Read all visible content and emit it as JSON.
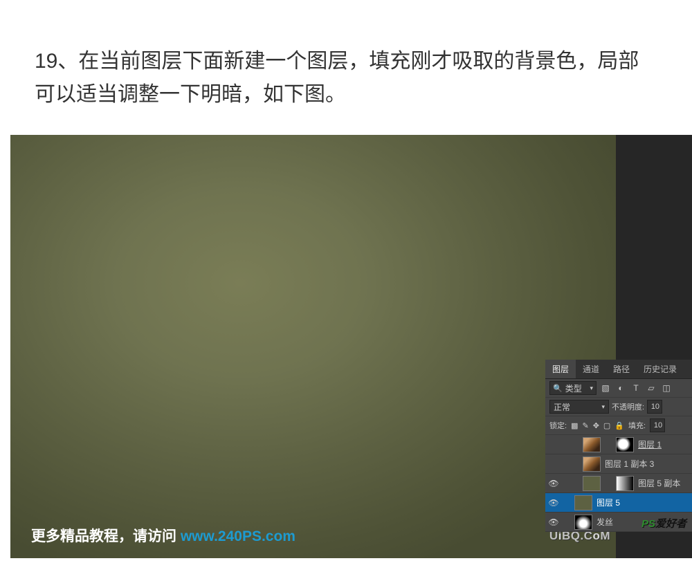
{
  "instruction": "19、在当前图层下面新建一个图层，填充刚才吸取的背景色，局部可以适当调整一下明暗，如下图。",
  "footer": {
    "prefix": "更多精品教程，请访问 ",
    "link": "www.240PS.com"
  },
  "panel": {
    "tabs": [
      "图层",
      "通道",
      "路径",
      "历史记录"
    ],
    "filter_label": "类型",
    "blend_mode": "正常",
    "opacity_label": "不透明度:",
    "opacity_value": "10",
    "lock_label": "锁定:",
    "fill_label": "填充:",
    "fill_value": "10",
    "layers": [
      {
        "name": "图层 1",
        "visible": false,
        "underline": true
      },
      {
        "name": "图层 1 副本 3",
        "visible": false
      },
      {
        "name": "图层 5 副本",
        "visible": true
      },
      {
        "name": "图层 5",
        "visible": true,
        "selected": true
      },
      {
        "name": "发丝",
        "visible": true
      }
    ]
  },
  "watermark": {
    "uibq": "UiBQ.CoM",
    "ps": "PS",
    "rest": "爱好者"
  }
}
